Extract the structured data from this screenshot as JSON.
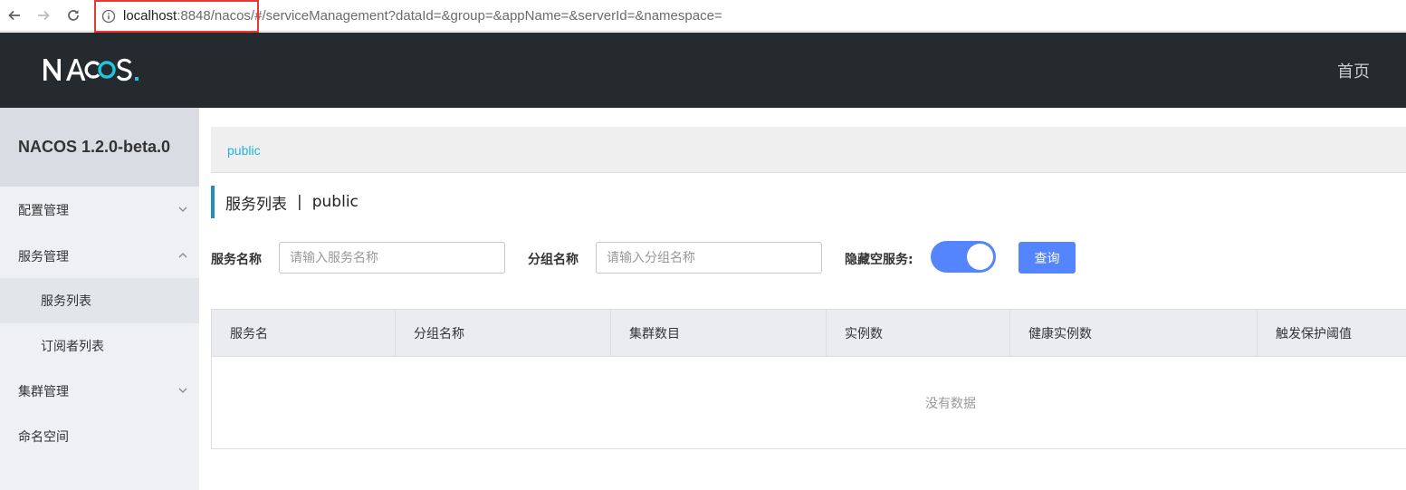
{
  "browser": {
    "url_host": "localhost",
    "url_rest": ":8848/nacos/#/serviceManagement?dataId=&group=&appName=&serverId=&namespace="
  },
  "header": {
    "logo_text": "NACOS.",
    "home_label": "首页"
  },
  "sidebar": {
    "version": "NACOS 1.2.0-beta.0",
    "items": [
      {
        "label": "配置管理",
        "expanded": false
      },
      {
        "label": "服务管理",
        "expanded": true
      },
      {
        "label": "服务列表",
        "active": true
      },
      {
        "label": "订阅者列表"
      },
      {
        "label": "集群管理",
        "expanded": false
      },
      {
        "label": "命名空间"
      }
    ]
  },
  "main": {
    "namespace": "public",
    "title": "服务列表",
    "title_separator": "|",
    "title_namespace": "public",
    "filters": {
      "service_name_label": "服务名称",
      "service_name_placeholder": "请输入服务名称",
      "group_name_label": "分组名称",
      "group_name_placeholder": "请输入分组名称",
      "hide_empty_label": "隐藏空服务:",
      "hide_empty_on": true,
      "query_label": "查询"
    },
    "table": {
      "columns": [
        "服务名",
        "分组名称",
        "集群数目",
        "实例数",
        "健康实例数",
        "触发保护阈值"
      ],
      "empty_text": "没有数据"
    }
  },
  "colors": {
    "topbar": "#252a2f",
    "accent": "#5584ff",
    "link": "#1fb3d7",
    "highlight_box": "#e53935"
  }
}
